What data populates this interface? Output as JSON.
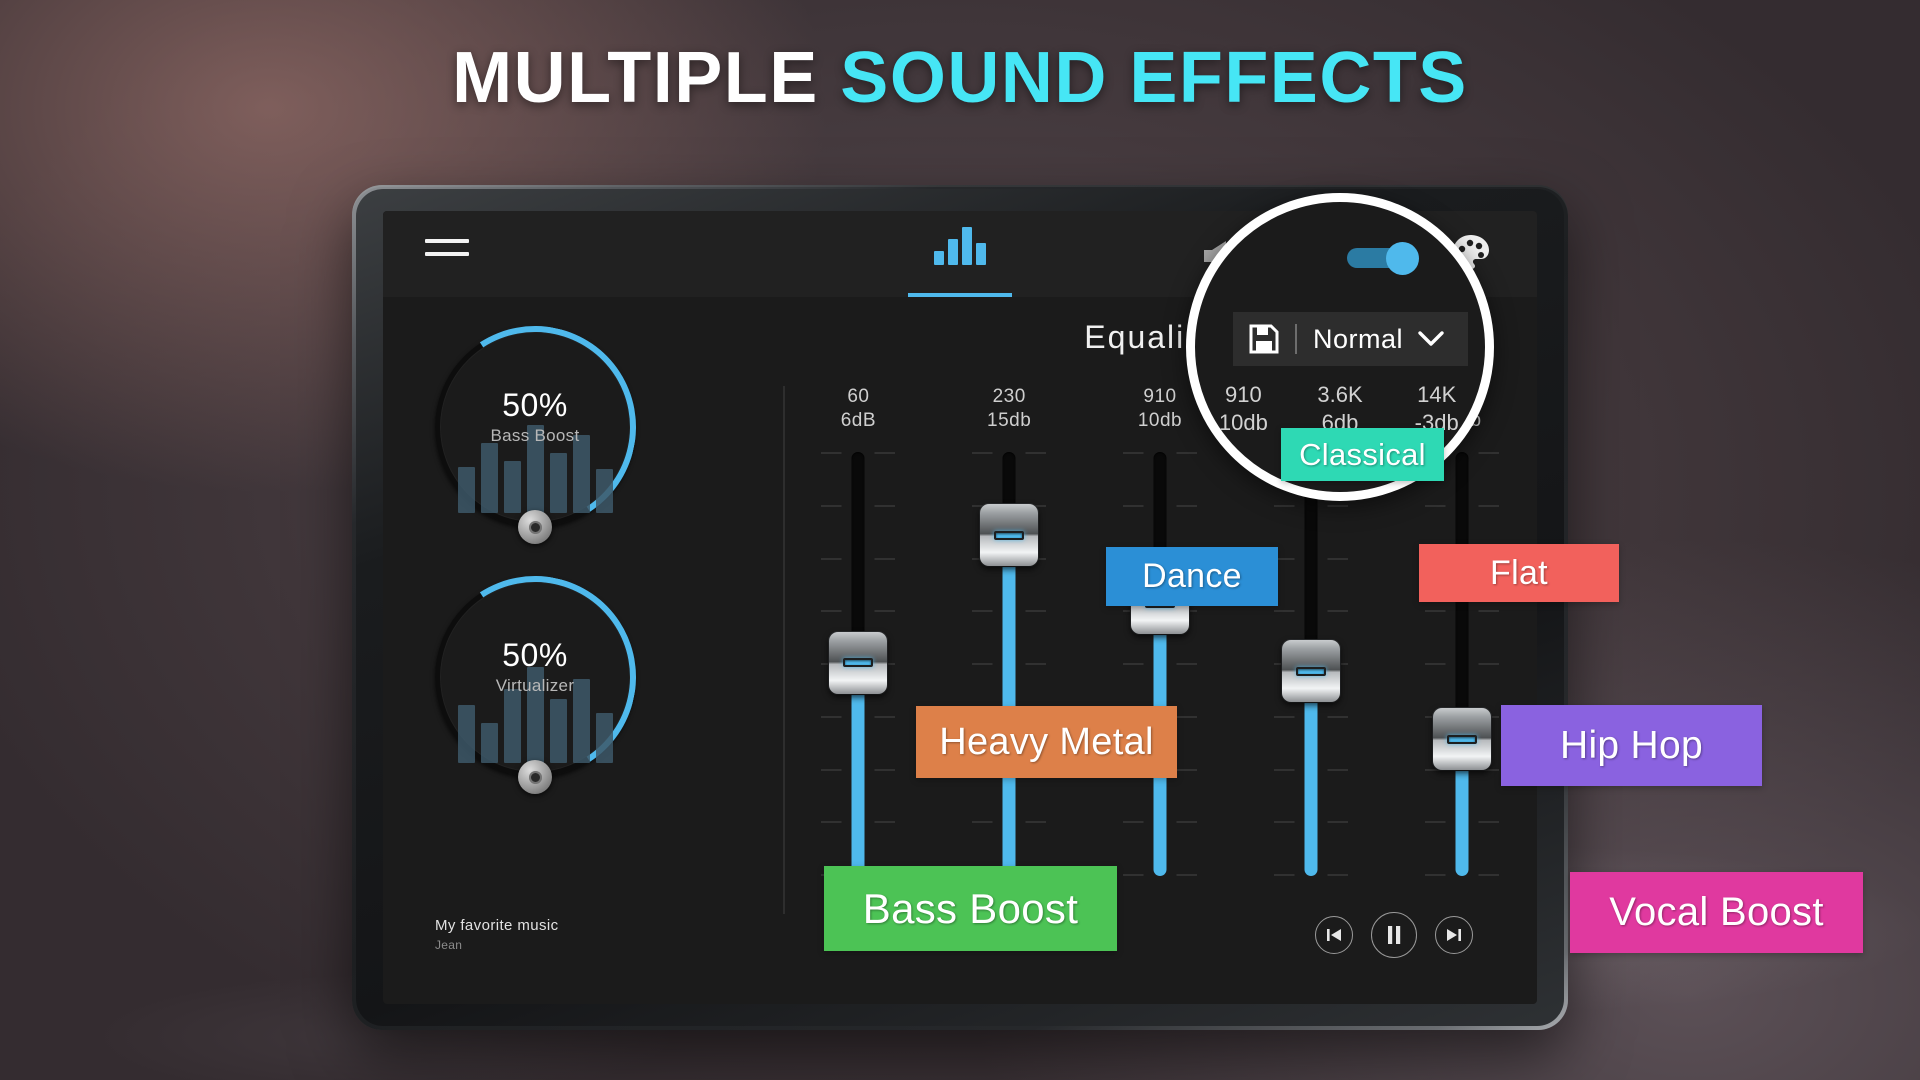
{
  "headline": {
    "part1": "MULTIPLE ",
    "part2": "SOUND EFFECTS",
    "color1": "#ffffff",
    "color2": "#46e6f5"
  },
  "app": {
    "topbar": {
      "menu_label": "menu",
      "tab_equalizer_label": "Equalizer tab",
      "volume_boost_label": "volume boost",
      "power_toggle_state": "on",
      "theme_label": "theme"
    },
    "left_panel": {
      "knobs": [
        {
          "percent": "50%",
          "label": "Bass Boost"
        },
        {
          "percent": "50%",
          "label": "Virtualizer"
        }
      ],
      "now_playing": {
        "title": "My favorite music",
        "artist": "Jean"
      }
    },
    "equalizer": {
      "title": "Equalizer",
      "bands": [
        {
          "freq": "60",
          "gain": "6dB"
        },
        {
          "freq": "230",
          "gain": "15db"
        },
        {
          "freq": "910",
          "gain": "10db"
        },
        {
          "freq": "3.6K",
          "gain": "6db"
        },
        {
          "freq": "14K",
          "gain": "-3db"
        }
      ]
    },
    "playback": {
      "previous_label": "previous",
      "pause_label": "pause",
      "next_label": "next"
    }
  },
  "magnifier": {
    "toggle_state": "on",
    "preset": {
      "save_label": "save",
      "name": "Normal",
      "chevron": "down"
    },
    "bands": [
      {
        "freq": "910",
        "gain": "10db"
      },
      {
        "freq": "3.6K",
        "gain": "6db"
      },
      {
        "freq": "14K",
        "gain": "-3db"
      }
    ]
  },
  "presets": [
    {
      "label": "Classical",
      "color": "#2ed9b4",
      "text_color": "#ffffff"
    },
    {
      "label": "Dance",
      "color": "#2b8fd6",
      "text_color": "#ffffff"
    },
    {
      "label": "Flat",
      "color": "#f2615c",
      "text_color": "#ffffff"
    },
    {
      "label": "Heavy Metal",
      "color": "#dd8049",
      "text_color": "#ffffff"
    },
    {
      "label": "Hip Hop",
      "color": "#8a62e0",
      "text_color": "#ffffff"
    },
    {
      "label": "Bass Boost",
      "color": "#4cc355",
      "text_color": "#ffffff"
    },
    {
      "label": "Vocal Boost",
      "color": "#e0399f",
      "text_color": "#ffffff"
    }
  ]
}
